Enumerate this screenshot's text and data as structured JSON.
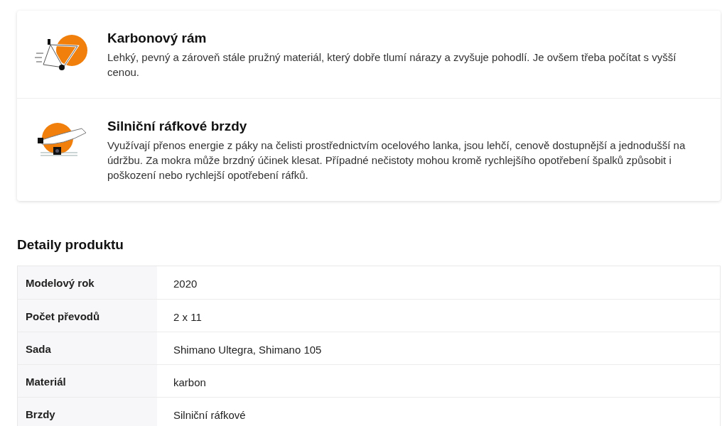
{
  "features": [
    {
      "kind": "frame",
      "title": "Karbonový rám",
      "description": "Lehký, pevný a zároveň stále pružný materiál, který dobře tlumí nárazy a zvyšuje pohodlí. Je ovšem třeba počítat s vyšší cenou."
    },
    {
      "kind": "brake",
      "title": "Silniční ráfkové brzdy",
      "description": "Využívají přenos energie z páky na čelisti prostřednictvím ocelového lanka, jsou lehčí, cenově dostupnější a jednodušší na údržbu. Za mokra může brzdný účinek klesat. Případné nečistoty mohou kromě rychlejšího opotřebení špalků způsobit i poškození nebo rychlejší opotřebení ráfků."
    }
  ],
  "details": {
    "title": "Detaily produktu",
    "rows": [
      {
        "label": "Modelový rok",
        "value": "2020"
      },
      {
        "label": "Počet převodů",
        "value": "2 x 11"
      },
      {
        "label": "Sada",
        "value": "Shimano Ultegra, Shimano 105"
      },
      {
        "label": "Materiál",
        "value": "karbon"
      },
      {
        "label": "Brzdy",
        "value": "Silniční ráfkové"
      }
    ]
  }
}
